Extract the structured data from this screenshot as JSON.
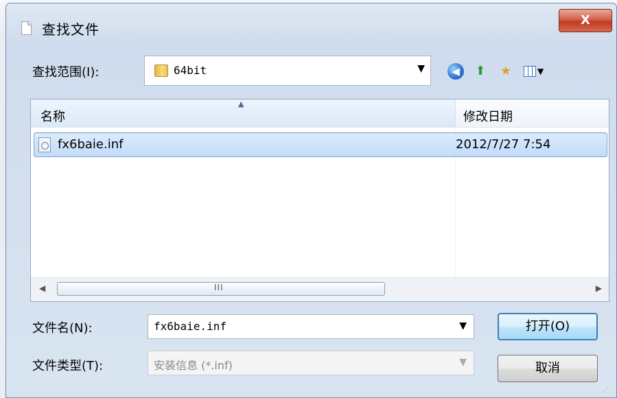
{
  "window": {
    "title": "查找文件",
    "close_label": "X"
  },
  "lookin": {
    "label": "查找范围(I):",
    "value": "64bit"
  },
  "toolbar": {
    "back_icon": "back-arrow-icon",
    "up_icon": "up-folder-icon",
    "newfolder_icon": "new-folder-icon",
    "view_icon": "view-menu-icon"
  },
  "filelist": {
    "columns": [
      "名称",
      "修改日期"
    ],
    "rows": [
      {
        "name": "fx6baie.inf",
        "date": "2012/7/27 7:54",
        "selected": true
      }
    ],
    "scroll_grip": "III"
  },
  "filename": {
    "label": "文件名(N):",
    "value": "fx6baie.inf"
  },
  "filetype": {
    "label": "文件类型(T):",
    "value": "安装信息 (*.inf)"
  },
  "buttons": {
    "open": "打开(O)",
    "cancel": "取消"
  },
  "colors": {
    "accent": "#3c7fb1",
    "close": "#c13b22",
    "selection": "#c1dcfa"
  }
}
